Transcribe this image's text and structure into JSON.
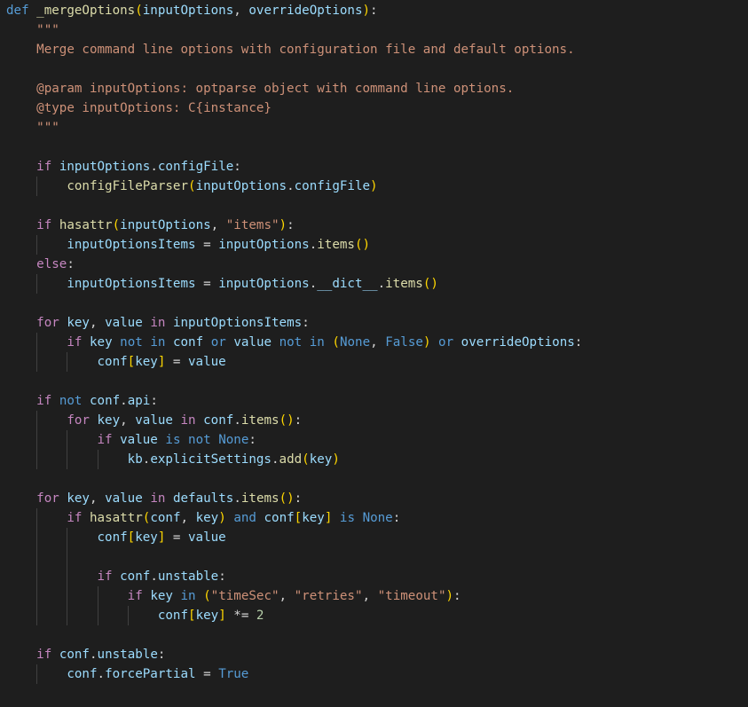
{
  "editor": {
    "language": "python",
    "theme": {
      "background": "#1e1e1e",
      "indent_guide": "#404040",
      "colors": {
        "kw": "#569cd6",
        "ctl": "#c586c0",
        "fn": "#dcdcaa",
        "var": "#9cdcfe",
        "str": "#ce9178",
        "num": "#b5cea8",
        "cst": "#569cd6",
        "pun": "#d4d4d4",
        "b1": "#ffd700",
        "b2": "#da70d6",
        "b3": "#179fff"
      }
    },
    "lines": [
      {
        "indent": 0,
        "tokens": [
          [
            "def",
            "kw"
          ],
          [
            " ",
            "pun"
          ],
          [
            "_mergeOptions",
            "fn"
          ],
          [
            "(",
            "b1"
          ],
          [
            "inputOptions",
            "var"
          ],
          [
            ", ",
            "pun"
          ],
          [
            "overrideOptions",
            "var"
          ],
          [
            ")",
            "b1"
          ],
          [
            ":",
            "pun"
          ]
        ]
      },
      {
        "indent": 1,
        "tokens": [
          [
            "\"\"\"",
            "str"
          ]
        ]
      },
      {
        "indent": 1,
        "tokens": [
          [
            "Merge command line options with configuration file and default options.",
            "str"
          ]
        ]
      },
      {
        "indent": 1,
        "tokens": []
      },
      {
        "indent": 1,
        "tokens": [
          [
            "@param inputOptions: optparse object with command line options.",
            "str"
          ]
        ]
      },
      {
        "indent": 1,
        "tokens": [
          [
            "@type inputOptions: C{instance}",
            "str"
          ]
        ]
      },
      {
        "indent": 1,
        "tokens": [
          [
            "\"\"\"",
            "str"
          ]
        ]
      },
      {
        "indent": 1,
        "tokens": []
      },
      {
        "indent": 1,
        "tokens": [
          [
            "if",
            "ctl"
          ],
          [
            " ",
            "pun"
          ],
          [
            "inputOptions",
            "var"
          ],
          [
            ".",
            "pun"
          ],
          [
            "configFile",
            "var"
          ],
          [
            ":",
            "pun"
          ]
        ]
      },
      {
        "indent": 2,
        "tokens": [
          [
            "configFileParser",
            "fn"
          ],
          [
            "(",
            "b1"
          ],
          [
            "inputOptions",
            "var"
          ],
          [
            ".",
            "pun"
          ],
          [
            "configFile",
            "var"
          ],
          [
            ")",
            "b1"
          ]
        ]
      },
      {
        "indent": 1,
        "tokens": []
      },
      {
        "indent": 1,
        "tokens": [
          [
            "if",
            "ctl"
          ],
          [
            " ",
            "pun"
          ],
          [
            "hasattr",
            "fn"
          ],
          [
            "(",
            "b1"
          ],
          [
            "inputOptions",
            "var"
          ],
          [
            ", ",
            "pun"
          ],
          [
            "\"items\"",
            "str"
          ],
          [
            ")",
            "b1"
          ],
          [
            ":",
            "pun"
          ]
        ]
      },
      {
        "indent": 2,
        "tokens": [
          [
            "inputOptionsItems",
            "var"
          ],
          [
            " = ",
            "pun"
          ],
          [
            "inputOptions",
            "var"
          ],
          [
            ".",
            "pun"
          ],
          [
            "items",
            "fn"
          ],
          [
            "()",
            "b1"
          ]
        ]
      },
      {
        "indent": 1,
        "tokens": [
          [
            "else",
            "ctl"
          ],
          [
            ":",
            "pun"
          ]
        ]
      },
      {
        "indent": 2,
        "tokens": [
          [
            "inputOptionsItems",
            "var"
          ],
          [
            " = ",
            "pun"
          ],
          [
            "inputOptions",
            "var"
          ],
          [
            ".",
            "pun"
          ],
          [
            "__dict__",
            "var"
          ],
          [
            ".",
            "pun"
          ],
          [
            "items",
            "fn"
          ],
          [
            "()",
            "b1"
          ]
        ]
      },
      {
        "indent": 1,
        "tokens": []
      },
      {
        "indent": 1,
        "tokens": [
          [
            "for",
            "ctl"
          ],
          [
            " ",
            "pun"
          ],
          [
            "key",
            "var"
          ],
          [
            ", ",
            "pun"
          ],
          [
            "value",
            "var"
          ],
          [
            " ",
            "pun"
          ],
          [
            "in",
            "ctl"
          ],
          [
            " ",
            "pun"
          ],
          [
            "inputOptionsItems",
            "var"
          ],
          [
            ":",
            "pun"
          ]
        ]
      },
      {
        "indent": 2,
        "tokens": [
          [
            "if",
            "ctl"
          ],
          [
            " ",
            "pun"
          ],
          [
            "key",
            "var"
          ],
          [
            " ",
            "pun"
          ],
          [
            "not",
            "kw"
          ],
          [
            " ",
            "pun"
          ],
          [
            "in",
            "kw"
          ],
          [
            " ",
            "pun"
          ],
          [
            "conf",
            "var"
          ],
          [
            " ",
            "pun"
          ],
          [
            "or",
            "kw"
          ],
          [
            " ",
            "pun"
          ],
          [
            "value",
            "var"
          ],
          [
            " ",
            "pun"
          ],
          [
            "not",
            "kw"
          ],
          [
            " ",
            "pun"
          ],
          [
            "in",
            "kw"
          ],
          [
            " ",
            "pun"
          ],
          [
            "(",
            "b1"
          ],
          [
            "None",
            "cst"
          ],
          [
            ", ",
            "pun"
          ],
          [
            "False",
            "cst"
          ],
          [
            ")",
            "b1"
          ],
          [
            " ",
            "pun"
          ],
          [
            "or",
            "kw"
          ],
          [
            " ",
            "pun"
          ],
          [
            "overrideOptions",
            "var"
          ],
          [
            ":",
            "pun"
          ]
        ]
      },
      {
        "indent": 3,
        "tokens": [
          [
            "conf",
            "var"
          ],
          [
            "[",
            "b1"
          ],
          [
            "key",
            "var"
          ],
          [
            "]",
            "b1"
          ],
          [
            " = ",
            "pun"
          ],
          [
            "value",
            "var"
          ]
        ]
      },
      {
        "indent": 1,
        "tokens": []
      },
      {
        "indent": 1,
        "tokens": [
          [
            "if",
            "ctl"
          ],
          [
            " ",
            "pun"
          ],
          [
            "not",
            "kw"
          ],
          [
            " ",
            "pun"
          ],
          [
            "conf",
            "var"
          ],
          [
            ".",
            "pun"
          ],
          [
            "api",
            "var"
          ],
          [
            ":",
            "pun"
          ]
        ]
      },
      {
        "indent": 2,
        "tokens": [
          [
            "for",
            "ctl"
          ],
          [
            " ",
            "pun"
          ],
          [
            "key",
            "var"
          ],
          [
            ", ",
            "pun"
          ],
          [
            "value",
            "var"
          ],
          [
            " ",
            "pun"
          ],
          [
            "in",
            "ctl"
          ],
          [
            " ",
            "pun"
          ],
          [
            "conf",
            "var"
          ],
          [
            ".",
            "pun"
          ],
          [
            "items",
            "fn"
          ],
          [
            "()",
            "b1"
          ],
          [
            ":",
            "pun"
          ]
        ]
      },
      {
        "indent": 3,
        "tokens": [
          [
            "if",
            "ctl"
          ],
          [
            " ",
            "pun"
          ],
          [
            "value",
            "var"
          ],
          [
            " ",
            "pun"
          ],
          [
            "is",
            "kw"
          ],
          [
            " ",
            "pun"
          ],
          [
            "not",
            "kw"
          ],
          [
            " ",
            "pun"
          ],
          [
            "None",
            "cst"
          ],
          [
            ":",
            "pun"
          ]
        ]
      },
      {
        "indent": 4,
        "tokens": [
          [
            "kb",
            "var"
          ],
          [
            ".",
            "pun"
          ],
          [
            "explicitSettings",
            "var"
          ],
          [
            ".",
            "pun"
          ],
          [
            "add",
            "fn"
          ],
          [
            "(",
            "b1"
          ],
          [
            "key",
            "var"
          ],
          [
            ")",
            "b1"
          ]
        ]
      },
      {
        "indent": 1,
        "tokens": []
      },
      {
        "indent": 1,
        "tokens": [
          [
            "for",
            "ctl"
          ],
          [
            " ",
            "pun"
          ],
          [
            "key",
            "var"
          ],
          [
            ", ",
            "pun"
          ],
          [
            "value",
            "var"
          ],
          [
            " ",
            "pun"
          ],
          [
            "in",
            "ctl"
          ],
          [
            " ",
            "pun"
          ],
          [
            "defaults",
            "var"
          ],
          [
            ".",
            "pun"
          ],
          [
            "items",
            "fn"
          ],
          [
            "()",
            "b1"
          ],
          [
            ":",
            "pun"
          ]
        ]
      },
      {
        "indent": 2,
        "tokens": [
          [
            "if",
            "ctl"
          ],
          [
            " ",
            "pun"
          ],
          [
            "hasattr",
            "fn"
          ],
          [
            "(",
            "b1"
          ],
          [
            "conf",
            "var"
          ],
          [
            ", ",
            "pun"
          ],
          [
            "key",
            "var"
          ],
          [
            ")",
            "b1"
          ],
          [
            " ",
            "pun"
          ],
          [
            "and",
            "kw"
          ],
          [
            " ",
            "pun"
          ],
          [
            "conf",
            "var"
          ],
          [
            "[",
            "b1"
          ],
          [
            "key",
            "var"
          ],
          [
            "]",
            "b1"
          ],
          [
            " ",
            "pun"
          ],
          [
            "is",
            "kw"
          ],
          [
            " ",
            "pun"
          ],
          [
            "None",
            "cst"
          ],
          [
            ":",
            "pun"
          ]
        ]
      },
      {
        "indent": 3,
        "tokens": [
          [
            "conf",
            "var"
          ],
          [
            "[",
            "b1"
          ],
          [
            "key",
            "var"
          ],
          [
            "]",
            "b1"
          ],
          [
            " = ",
            "pun"
          ],
          [
            "value",
            "var"
          ]
        ]
      },
      {
        "indent": 3,
        "tokens": []
      },
      {
        "indent": 3,
        "tokens": [
          [
            "if",
            "ctl"
          ],
          [
            " ",
            "pun"
          ],
          [
            "conf",
            "var"
          ],
          [
            ".",
            "pun"
          ],
          [
            "unstable",
            "var"
          ],
          [
            ":",
            "pun"
          ]
        ]
      },
      {
        "indent": 4,
        "tokens": [
          [
            "if",
            "ctl"
          ],
          [
            " ",
            "pun"
          ],
          [
            "key",
            "var"
          ],
          [
            " ",
            "pun"
          ],
          [
            "in",
            "kw"
          ],
          [
            " ",
            "pun"
          ],
          [
            "(",
            "b1"
          ],
          [
            "\"timeSec\"",
            "str"
          ],
          [
            ", ",
            "pun"
          ],
          [
            "\"retries\"",
            "str"
          ],
          [
            ", ",
            "pun"
          ],
          [
            "\"timeout\"",
            "str"
          ],
          [
            ")",
            "b1"
          ],
          [
            ":",
            "pun"
          ]
        ]
      },
      {
        "indent": 5,
        "tokens": [
          [
            "conf",
            "var"
          ],
          [
            "[",
            "b1"
          ],
          [
            "key",
            "var"
          ],
          [
            "]",
            "b1"
          ],
          [
            " *= ",
            "pun"
          ],
          [
            "2",
            "num"
          ]
        ]
      },
      {
        "indent": 1,
        "tokens": []
      },
      {
        "indent": 1,
        "tokens": [
          [
            "if",
            "ctl"
          ],
          [
            " ",
            "pun"
          ],
          [
            "conf",
            "var"
          ],
          [
            ".",
            "pun"
          ],
          [
            "unstable",
            "var"
          ],
          [
            ":",
            "pun"
          ]
        ]
      },
      {
        "indent": 2,
        "tokens": [
          [
            "conf",
            "var"
          ],
          [
            ".",
            "pun"
          ],
          [
            "forcePartial",
            "var"
          ],
          [
            " = ",
            "pun"
          ],
          [
            "True",
            "cst"
          ]
        ]
      },
      {
        "indent": 1,
        "tokens": []
      }
    ]
  }
}
